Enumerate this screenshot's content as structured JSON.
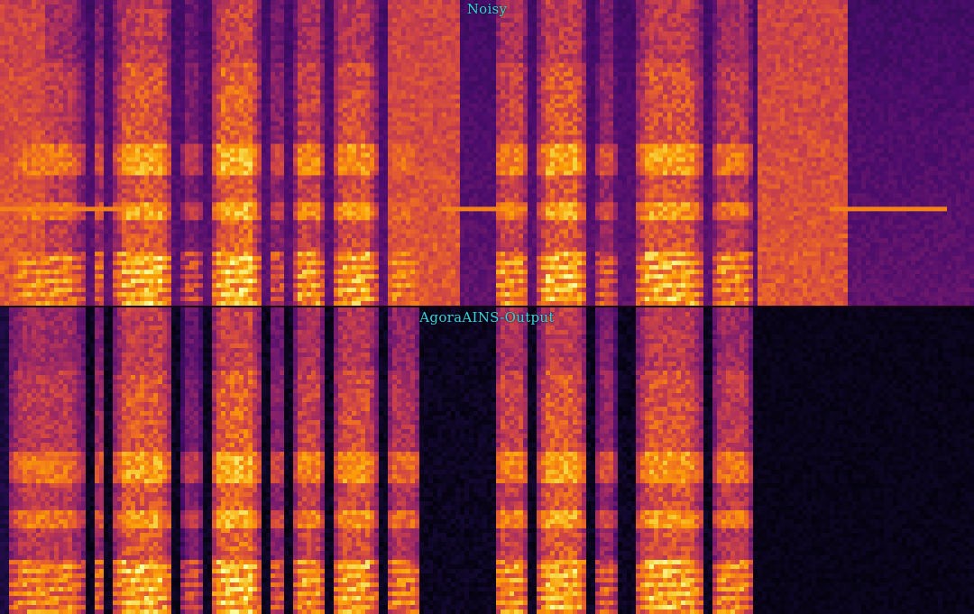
{
  "panels": [
    {
      "title": "Noisy",
      "background_level": 0.55,
      "speech_level": 0.95
    },
    {
      "title": "AgoraAINS-Output",
      "background_level": 0.03,
      "speech_level": 0.95
    }
  ],
  "colors": {
    "title": "#32d6e0",
    "colormap": [
      "#000004",
      "#1b0c41",
      "#4a0c6b",
      "#781c6d",
      "#a52c60",
      "#cf4446",
      "#ed6925",
      "#fb9b06",
      "#f7d13d",
      "#fcffa4"
    ]
  }
}
